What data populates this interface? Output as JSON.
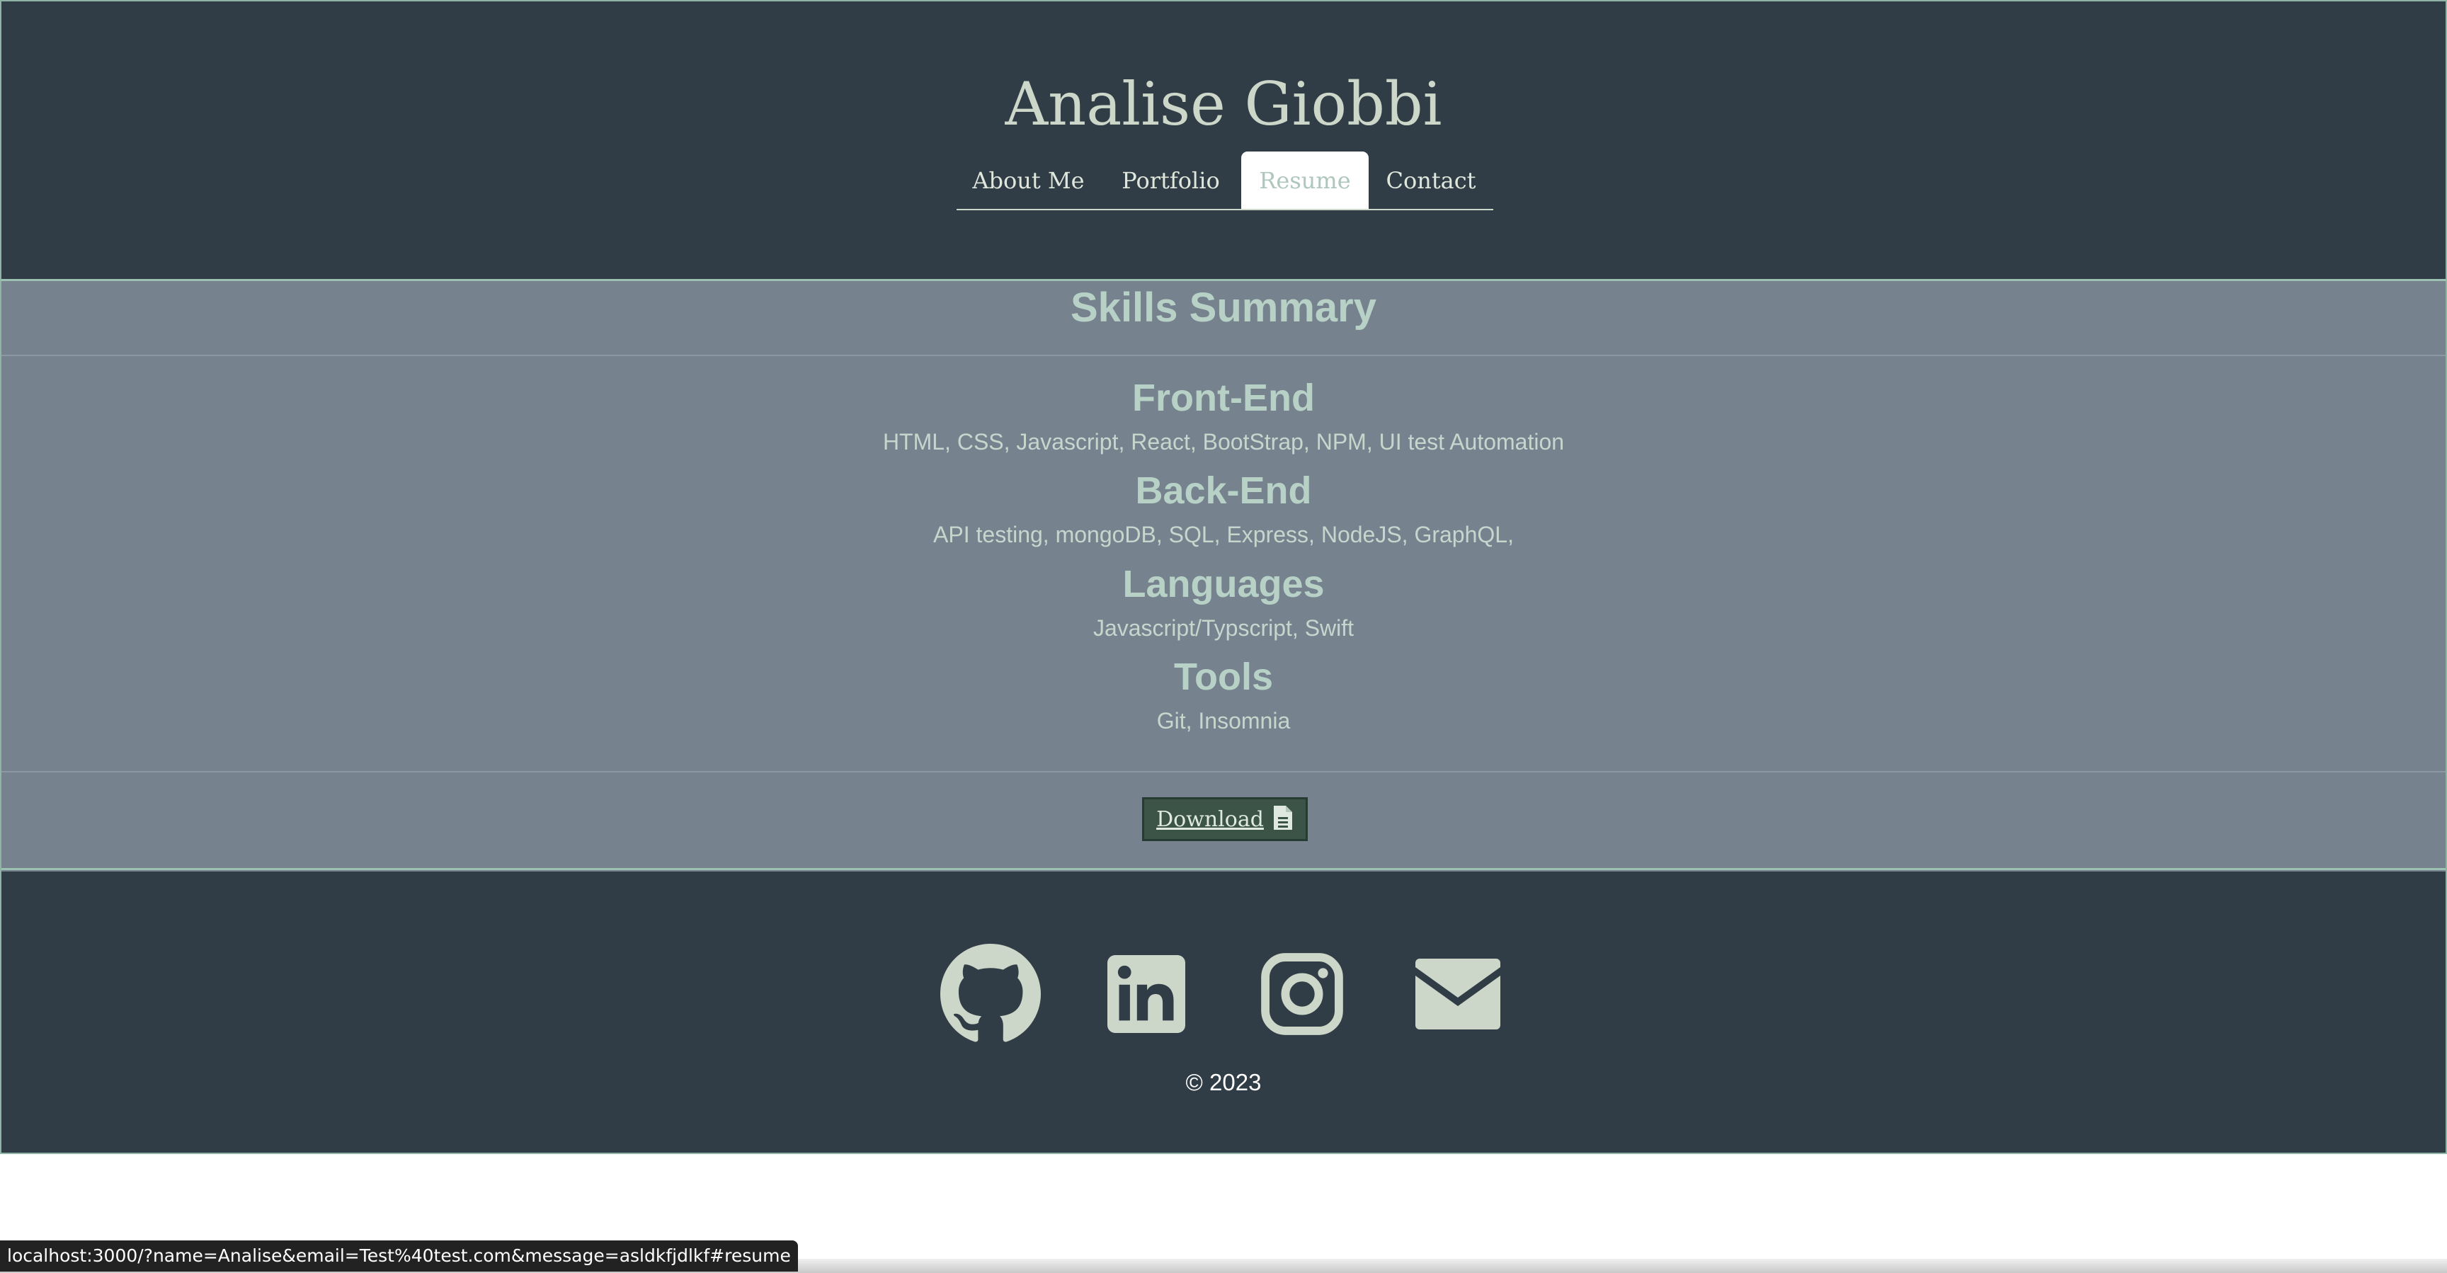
{
  "header": {
    "site_title": "Analise Giobbi",
    "nav": {
      "about": "About Me",
      "portfolio": "Portfolio",
      "resume": "Resume",
      "contact": "Contact"
    },
    "active_tab": "Resume"
  },
  "resume": {
    "title": "Skills Summary",
    "skills": [
      {
        "heading": "Front-End",
        "items": "HTML, CSS, Javascript, React, BootStrap, NPM, UI test Automation"
      },
      {
        "heading": "Back-End",
        "items": "API testing, mongoDB, SQL, Express, NodeJS, GraphQL,"
      },
      {
        "heading": "Languages",
        "items": "Javascript/Typscript, Swift"
      },
      {
        "heading": "Tools",
        "items": "Git, Insomnia"
      }
    ],
    "download_label": "Download",
    "download_icon": "file-icon"
  },
  "footer": {
    "social_icons": [
      "github-icon",
      "linkedin-icon",
      "instagram-icon",
      "email-icon"
    ],
    "copyright": "© 2023"
  },
  "status_bar": {
    "url": "localhost:3000/?name=Analise&email=Test%40test.com&message=asldkfjdlkf#resume"
  },
  "colors": {
    "header_bg": "#313d46",
    "section_bg": "#76838f",
    "accent_text": "#b8d1c6",
    "icon_color": "#ccd6c9",
    "download_bg": "#3c5448"
  }
}
